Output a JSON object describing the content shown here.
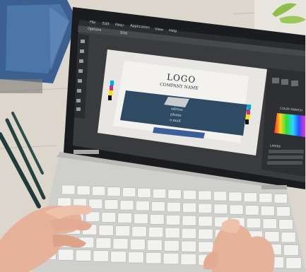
{
  "app": {
    "menu": [
      "File",
      "Edit",
      "Filter",
      "Application",
      "View",
      "Help"
    ],
    "options_label": "Options",
    "size_label": "Size"
  },
  "artwork": {
    "logo": "LOGO",
    "company": "COMPANY NAME",
    "contact_lines": [
      "adress",
      "phone",
      "e-mail"
    ]
  },
  "panels": {
    "layers_label": "LAYERS",
    "color_label": "COLOR SWATCH"
  },
  "colors": {
    "desk": "#d9d3ca",
    "laptop_body": "#c9c9c6",
    "screen_bezel": "#1b1c1f",
    "app_bg": "#3a3b3e",
    "card_navy": "#2f4a63",
    "skin": "#e8b49d"
  },
  "icons": [
    "tool-palette-icon",
    "color-picker-icon",
    "keyboard-icon",
    "pen-icon"
  ]
}
